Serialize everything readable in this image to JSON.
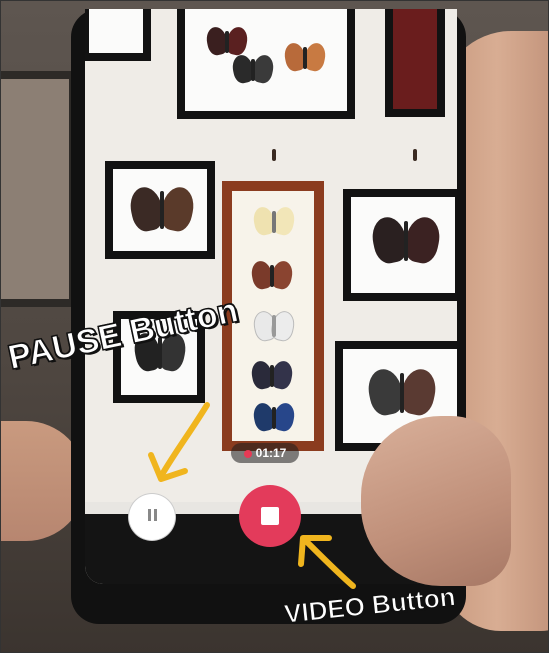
{
  "annotations": {
    "pause_label": "PAUSE Button",
    "video_label": "VIDEO Button",
    "arrow_color": "#f0b51e"
  },
  "recording": {
    "elapsed": "01:17",
    "indicator_color": "#e73a55"
  },
  "controls": {
    "pause_icon": "pause-icon",
    "stop_icon": "stop-icon",
    "stop_color": "#e33b5b"
  }
}
